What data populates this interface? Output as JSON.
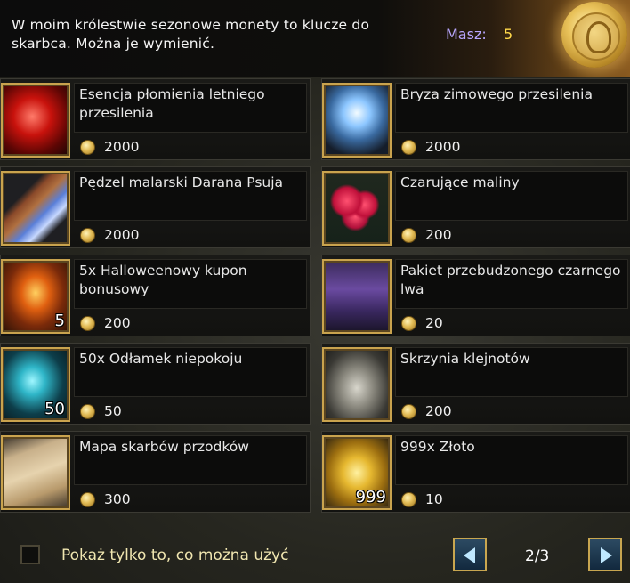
{
  "header": {
    "message": "W moim królestwie sezonowe monety to klucze do skarbca. Można je wymienić.",
    "have_label": "Masz:",
    "have_value": "5"
  },
  "items": [
    {
      "name": "Esencja płomienia letniego przesilenia",
      "price": "2000",
      "qty": "",
      "icon": "fire-orb-icon"
    },
    {
      "name": "Bryza zimowego przesilenia",
      "price": "2000",
      "qty": "",
      "icon": "crystal-ball-icon"
    },
    {
      "name": "Pędzel malarski Darana Psuja",
      "price": "2000",
      "qty": "",
      "icon": "paintbrush-icon"
    },
    {
      "name": "Czarujące maliny",
      "price": "200",
      "qty": "",
      "icon": "raspberries-icon"
    },
    {
      "name": "5x Halloweenowy kupon bonusowy",
      "price": "200",
      "qty": "5",
      "icon": "fire-chest-icon"
    },
    {
      "name": "Pakiet przebudzonego czarnego lwa",
      "price": "20",
      "qty": "",
      "icon": "purple-chest-icon"
    },
    {
      "name": "50x Odłamek niepokoju",
      "price": "50",
      "qty": "50",
      "icon": "crystal-shard-icon"
    },
    {
      "name": "Skrzynia klejnotów",
      "price": "200",
      "qty": "",
      "icon": "jewel-box-icon"
    },
    {
      "name": "Mapa skarbów przodków",
      "price": "300",
      "qty": "",
      "icon": "treasure-map-icon"
    },
    {
      "name": "999x Złoto",
      "price": "10",
      "qty": "999",
      "icon": "gold-coins-icon"
    }
  ],
  "footer": {
    "filter_label": "Pokaż tylko to, co można użyć",
    "filter_checked": false,
    "page_indicator": "2/3"
  },
  "colors": {
    "have_label": "#b9a7ff",
    "have_value": "#ffd84a",
    "frame_gold": "#c9a34e",
    "footer_label": "#f0e6b0"
  }
}
